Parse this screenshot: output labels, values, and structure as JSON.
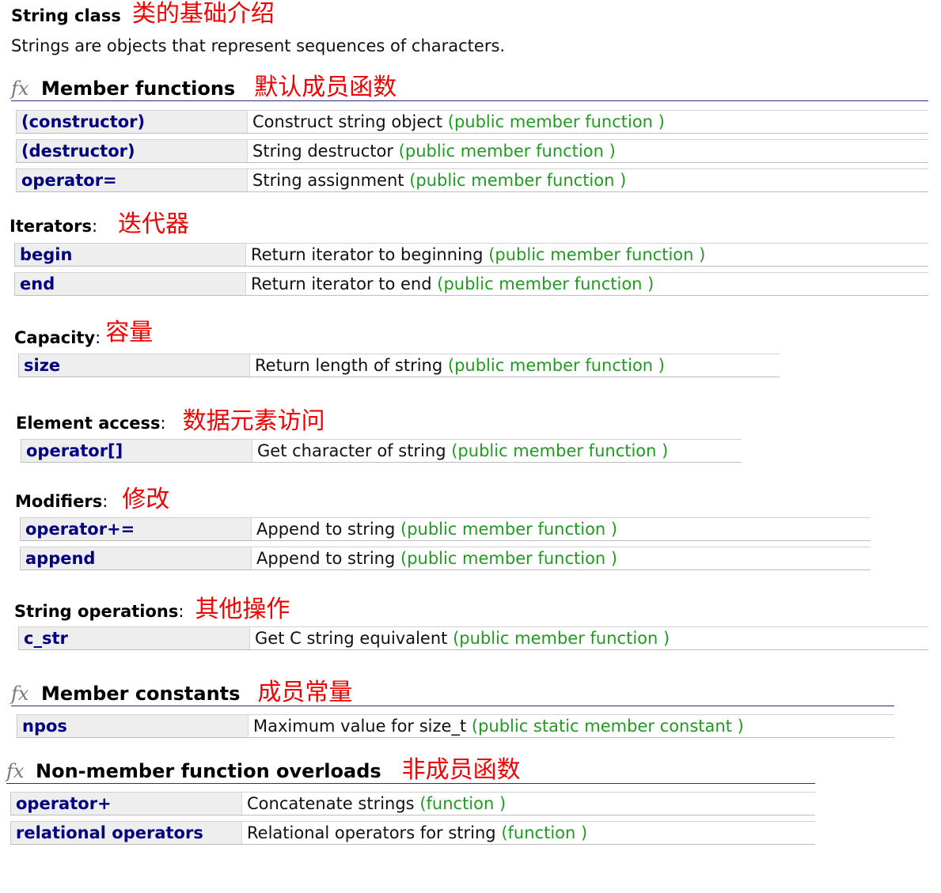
{
  "page": {
    "title": "String class",
    "title_note": "类的基础介绍",
    "description": "Strings are objects that represent sequences of characters."
  },
  "colors": {
    "member_link": "#000080",
    "annotation_red": "#f20000",
    "type_green": "#229922",
    "heading_rule": "#2b2b85",
    "name_cell_bg": "#eeeeee",
    "icon_gray": "#777777"
  },
  "member_functions": {
    "icon": "fx-icon",
    "title": "Member functions",
    "note": "默认成员函数",
    "rows": [
      {
        "name": "(constructor)",
        "desc": "Construct string object",
        "type": "(public member function )"
      },
      {
        "name": "(destructor)",
        "desc": "String destructor",
        "type": "(public member function )"
      },
      {
        "name": "operator=",
        "desc": "String assignment",
        "type": "(public member function )"
      }
    ]
  },
  "iterators": {
    "label": "Iterators",
    "colon": ":",
    "note": "迭代器",
    "rows": [
      {
        "name": "begin",
        "desc": "Return iterator to beginning",
        "type": "(public member function )"
      },
      {
        "name": "end",
        "desc": "Return iterator to end",
        "type": "(public member function )"
      }
    ]
  },
  "capacity": {
    "label": "Capacity",
    "colon": ":",
    "note": "容量",
    "rows": [
      {
        "name": "size",
        "desc": "Return length of string",
        "type": "(public member function )"
      }
    ]
  },
  "element_access": {
    "label": "Element access",
    "colon": ":",
    "note": "数据元素访问",
    "rows": [
      {
        "name": "operator[]",
        "desc": "Get character of string",
        "type": "(public member function )"
      }
    ]
  },
  "modifiers": {
    "label": "Modifiers",
    "colon": ":",
    "note": "修改",
    "rows": [
      {
        "name": "operator+=",
        "desc": "Append to string",
        "type": "(public member function )"
      },
      {
        "name": "append",
        "desc": "Append to string",
        "type": "(public member function )"
      }
    ]
  },
  "string_operations": {
    "label": "String operations",
    "colon": ":",
    "note": "其他操作",
    "rows": [
      {
        "name": "c_str",
        "desc": "Get C string equivalent",
        "type": "(public member function )"
      }
    ]
  },
  "member_constants": {
    "icon": "fx-icon",
    "title": "Member constants",
    "note": "成员常量",
    "rows": [
      {
        "name": "npos",
        "desc": "Maximum value for size_t",
        "type": "(public static member constant )"
      }
    ]
  },
  "non_member_overloads": {
    "icon": "fx-icon",
    "title": "Non-member function overloads",
    "note": "非成员函数",
    "rows": [
      {
        "name": "operator+",
        "desc": "Concatenate strings",
        "type": "(function )"
      },
      {
        "name": "relational operators",
        "desc": "Relational operators for string",
        "type": "(function )"
      }
    ]
  }
}
